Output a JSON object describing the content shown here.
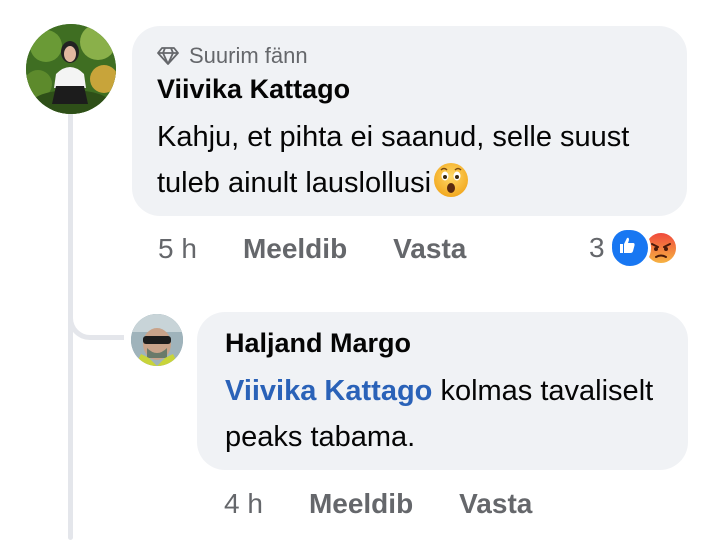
{
  "comment": {
    "badge_label": "Suurim fänn",
    "author": "Viivika Kattago",
    "text": "Kahju, et pihta ei saanud, selle suust tuleb ainult lauslollusi",
    "time": "5 h",
    "like_label": "Meeldib",
    "reply_label": "Vasta",
    "reaction_count": "3",
    "reactions": [
      "like-icon",
      "angry-icon"
    ],
    "emoji": "astonished-face"
  },
  "reply": {
    "author": "Haljand Margo",
    "mention": "Viivika Kattago",
    "text": " kolmas tavaliselt peaks tabama.",
    "time": "4 h",
    "like_label": "Meeldib",
    "reply_label": "Vasta"
  },
  "colors": {
    "bubble": "#f0f2f5",
    "meta_text": "#65676b",
    "mention": "#2a62b8",
    "like_blue": "#1877f2"
  }
}
